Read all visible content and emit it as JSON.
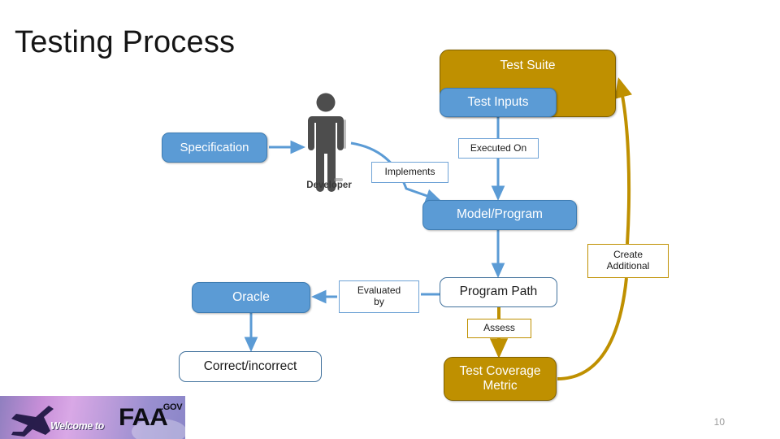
{
  "slide": {
    "title": "Testing Process",
    "page_number": "10"
  },
  "colors": {
    "blue_fill": "#5B9BD5",
    "blue_border": "#41719C",
    "gold_fill": "#BF9000",
    "gold_border": "#7F6000",
    "white_fill": "#FFFFFF",
    "title_color": "#151515",
    "page_number_color": "#9A9A9A",
    "developer_color": "#4D4D4D"
  },
  "diagram": {
    "nodes": {
      "test_suite": "Test Suite",
      "test_inputs": "Test Inputs",
      "specification": "Specification",
      "model_program": "Model/Program",
      "oracle": "Oracle",
      "program_path": "Program Path",
      "correct_incorrect": "Correct/incorrect",
      "test_coverage_metric_line1": "Test Coverage",
      "test_coverage_metric_line2": "Metric"
    },
    "edge_labels": {
      "executed_on": "Executed On",
      "implements": "Implements",
      "evaluated_by_line1": "Evaluated",
      "evaluated_by_line2": "by",
      "create_additional_line1": "Create",
      "create_additional_line2": "Additional",
      "assess": "Assess"
    },
    "actor": {
      "developer_label": "Developer"
    }
  },
  "banner": {
    "welcome_text": "Welcome to",
    "wordmark": "FAA",
    "suffix": ".GOV"
  }
}
